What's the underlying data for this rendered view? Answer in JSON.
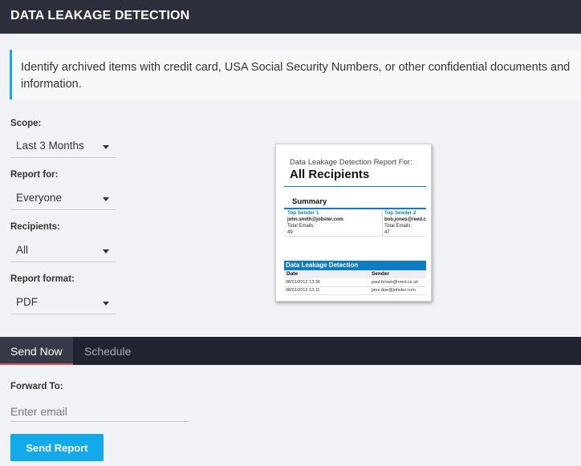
{
  "header": {
    "title": "DATA LEAKAGE DETECTION"
  },
  "info": {
    "text": "Identify archived items with credit card, USA Social Security Numbers, or other confidential documents and information."
  },
  "form": {
    "scope": {
      "label": "Scope:",
      "value": "Last 3 Months"
    },
    "report_for": {
      "label": "Report for:",
      "value": "Everyone"
    },
    "recipients": {
      "label": "Recipients:",
      "value": "All"
    },
    "report_format": {
      "label": "Report format:",
      "value": "PDF"
    }
  },
  "preview": {
    "caption": "Data Leakage Detection Report For:",
    "heading": "All Recipients",
    "summary": "Summary",
    "senders": [
      {
        "title": "Top Sender 1",
        "email": "john.smith@jobster.com",
        "emails_label": "Total Emails:",
        "emails_count": "49"
      },
      {
        "title": "Top Sender 2",
        "email": "bob.jones@reed.c",
        "emails_label": "Total Emails:",
        "emails_count": "47"
      }
    ],
    "table_title": "Data Leakage Detection",
    "columns": [
      "Date",
      "Sender"
    ],
    "rows": [
      [
        "08/01/2012 13:36",
        "paul.brown@reed.co.uk"
      ],
      [
        "08/01/2012 13:11",
        "jane.doe@jobster.com"
      ]
    ]
  },
  "tabs": {
    "send_now": "Send Now",
    "schedule": "Schedule"
  },
  "forward": {
    "label": "Forward To:",
    "placeholder": "Enter email"
  },
  "send_button": "Send Report",
  "colors": {
    "accent": "#12aaeb",
    "header_bg": "#2c2f3b",
    "tab_bar_bg": "#1f2430",
    "active_tab_underline": "#e0505a",
    "info_border": "#19a8e0"
  }
}
